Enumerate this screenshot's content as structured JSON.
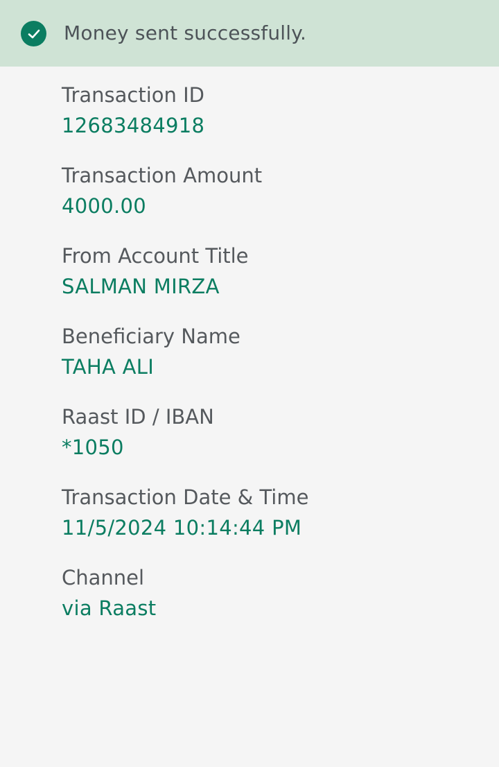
{
  "banner": {
    "message": "Money sent successfully.",
    "icon": "check-circle-icon",
    "background": "#cfe3d5",
    "accent": "#0b7d61"
  },
  "details": [
    {
      "label": "Transaction ID",
      "value": "12683484918"
    },
    {
      "label": "Transaction Amount",
      "value": "4000.00"
    },
    {
      "label": "From Account Title",
      "value": "SALMAN MIRZA"
    },
    {
      "label": "Beneficiary Name",
      "value": "TAHA ALI"
    },
    {
      "label": "Raast ID / IBAN",
      "value": "*1050"
    },
    {
      "label": "Transaction Date & Time",
      "value": "11/5/2024 10:14:44 PM"
    },
    {
      "label": "Channel",
      "value": "via Raast"
    }
  ]
}
